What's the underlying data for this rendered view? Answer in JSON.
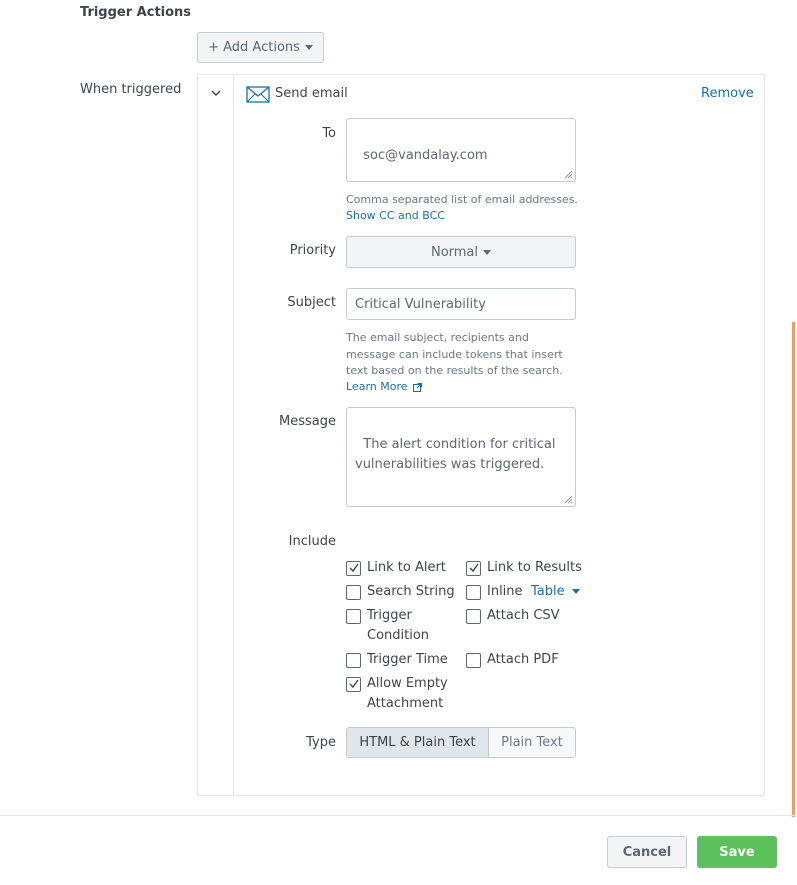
{
  "section_title": "Trigger Actions",
  "add_actions_label": "+ Add Actions",
  "when_triggered_label": "When triggered",
  "action": {
    "name": "Send email",
    "remove_label": "Remove",
    "to": {
      "label": "To",
      "value": "soc@vandalay.com",
      "help": "Comma separated list of email addresses.",
      "show_cc_bcc": "Show CC and BCC"
    },
    "priority": {
      "label": "Priority",
      "value": "Normal"
    },
    "subject": {
      "label": "Subject",
      "value": "Critical Vulnerability",
      "help_line1": "The email subject, recipients and",
      "help_line2": "message can include tokens that insert",
      "help_line3": "text based on the results of the search.",
      "learn_more": "Learn More"
    },
    "message": {
      "label": "Message",
      "value": "The alert condition for critical\nvulnerabilities was triggered."
    },
    "include": {
      "label": "Include",
      "options": {
        "link_to_alert": {
          "label": "Link to Alert",
          "checked": true
        },
        "link_to_results": {
          "label": "Link to Results",
          "checked": true
        },
        "search_string": {
          "label": "Search String",
          "checked": false
        },
        "inline": {
          "label": "Inline",
          "checked": false,
          "format": "Table"
        },
        "trigger_condition_l1": {
          "label": "Trigger",
          "checked": false
        },
        "trigger_condition_l2": "Condition",
        "attach_csv": {
          "label": "Attach CSV",
          "checked": false
        },
        "trigger_time": {
          "label": "Trigger Time",
          "checked": false
        },
        "attach_pdf": {
          "label": "Attach PDF",
          "checked": false
        },
        "allow_empty_l1": {
          "label": "Allow Empty",
          "checked": true
        },
        "allow_empty_l2": "Attachment"
      }
    },
    "type": {
      "label": "Type",
      "options": [
        "HTML & Plain Text",
        "Plain Text"
      ],
      "selected": "HTML & Plain Text"
    }
  },
  "footer": {
    "cancel_label": "Cancel",
    "save_label": "Save"
  },
  "colors": {
    "link": "#1a70a8",
    "save": "#5cc05c",
    "scroll_accent": "#ec9a6f"
  },
  "icons": [
    "chevron-down-icon",
    "envelope-icon",
    "external-link-icon",
    "checkmark-icon",
    "caret-down-icon",
    "resize-handle-icon"
  ]
}
